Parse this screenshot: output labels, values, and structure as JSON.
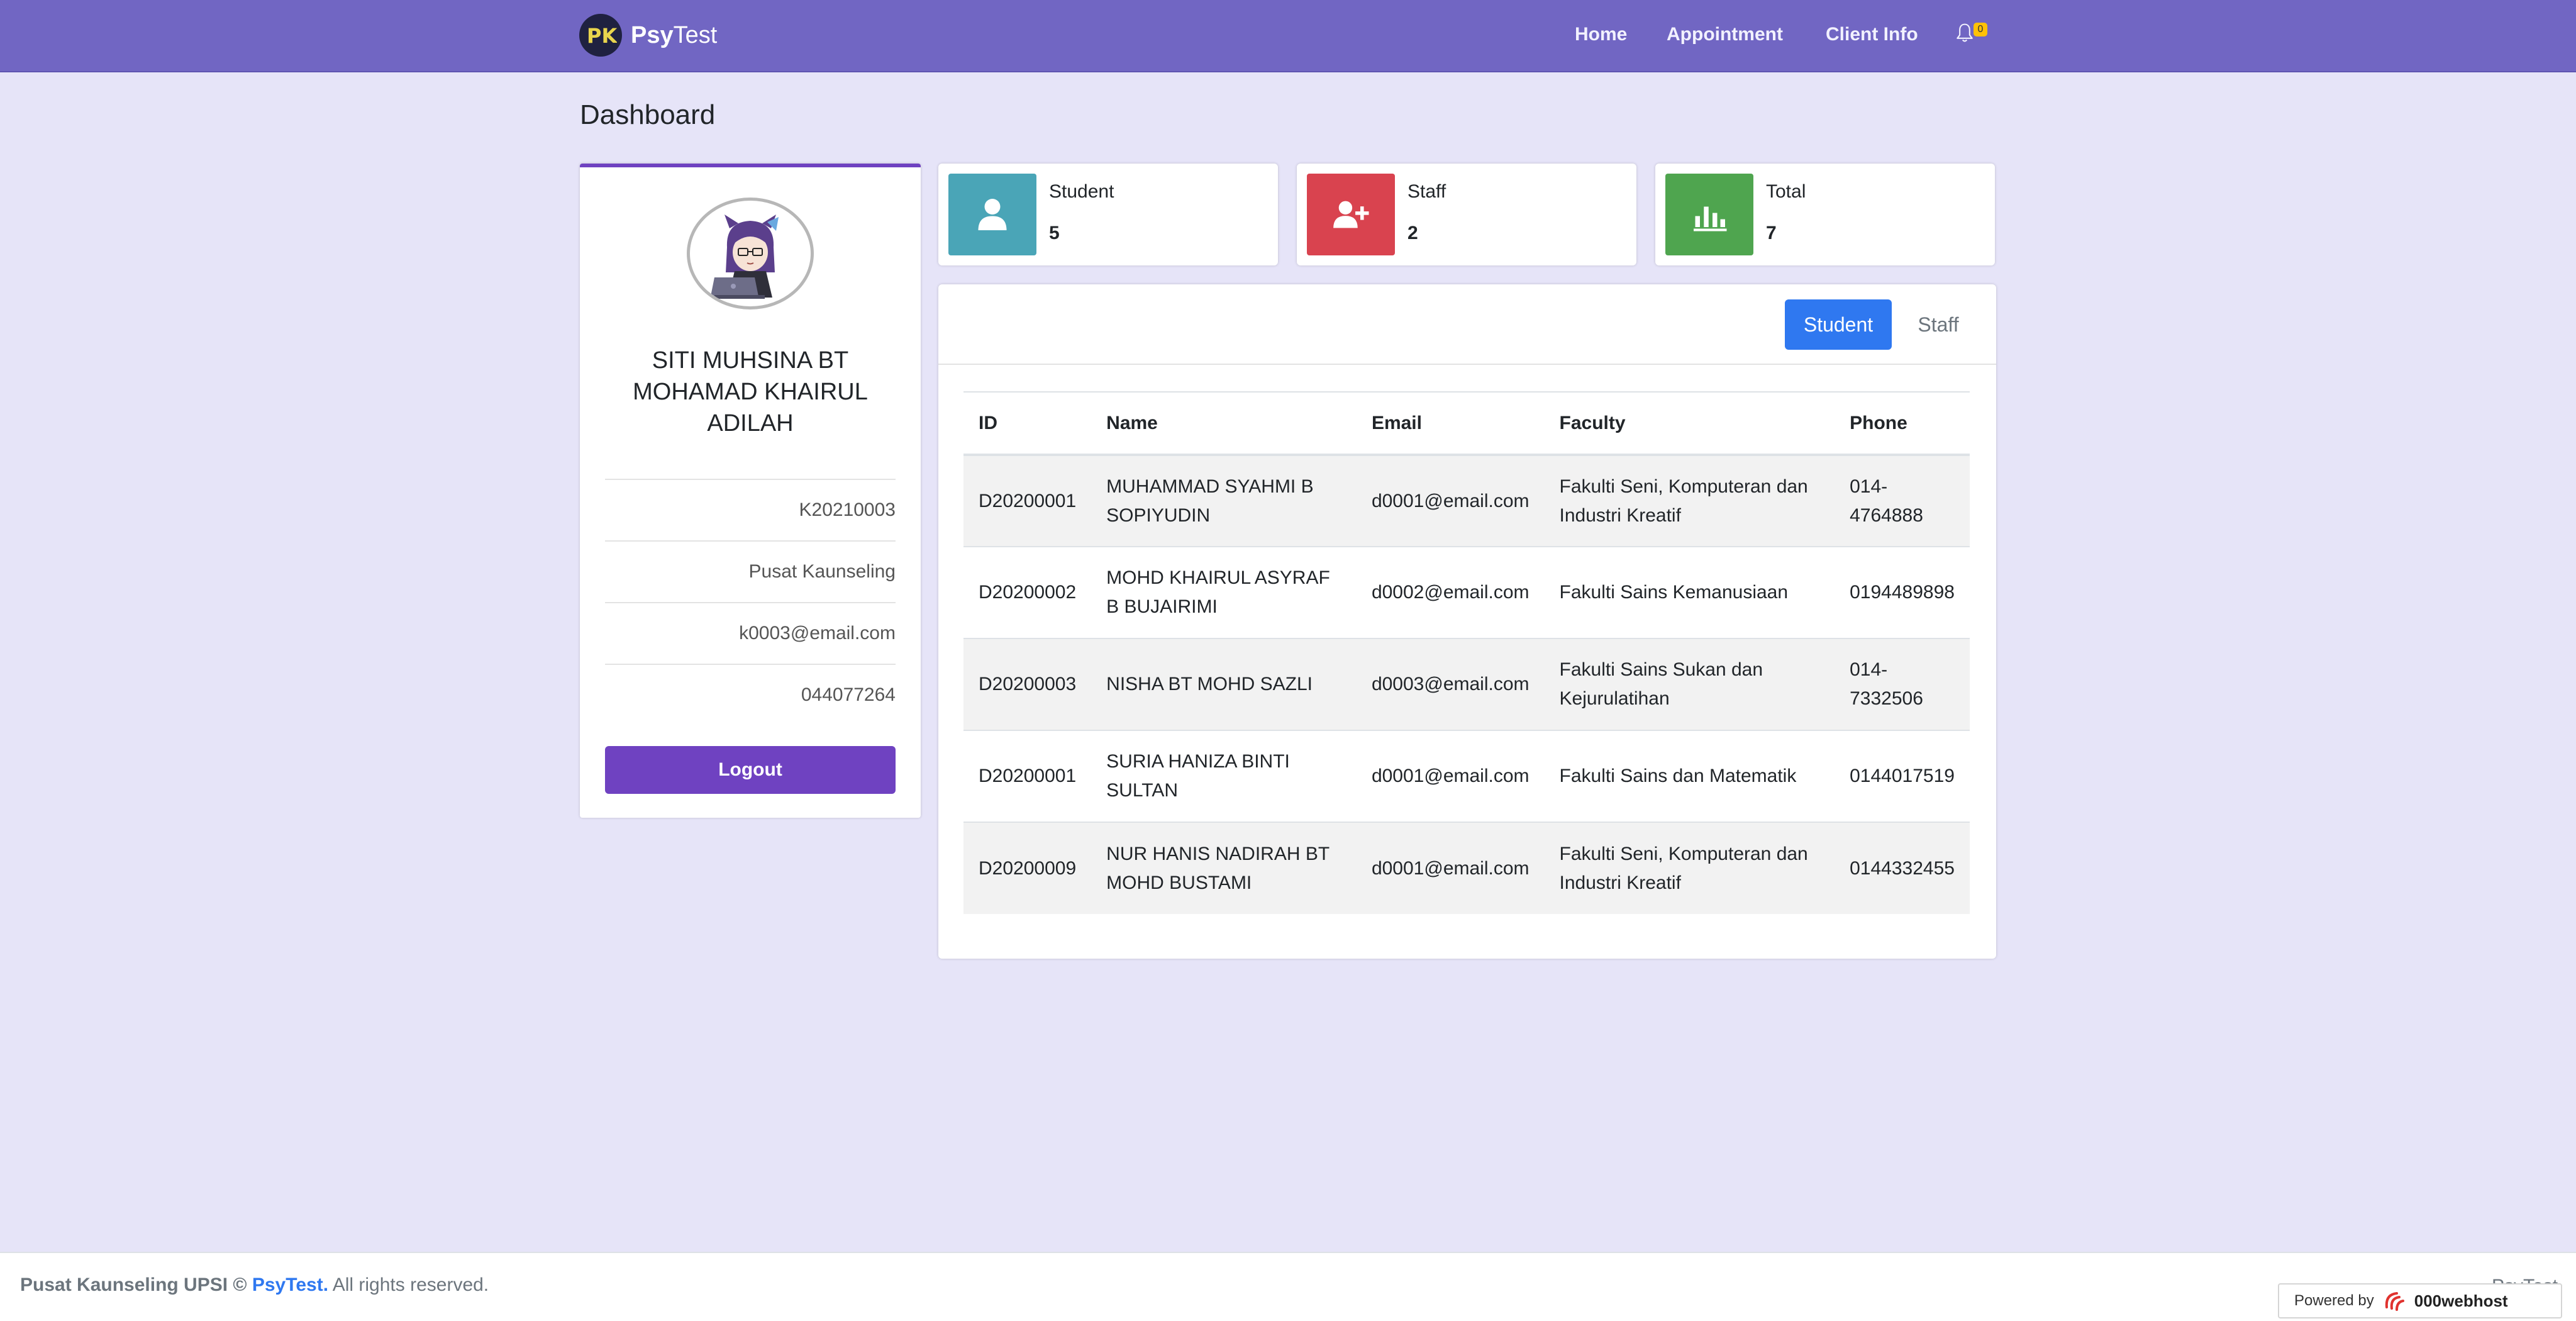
{
  "navbar": {
    "brand_bold": "Psy",
    "brand_light": "Test",
    "links": [
      {
        "label": "Home"
      },
      {
        "label": "Appointment"
      },
      {
        "label": "Client Info"
      }
    ],
    "notification_count": "0"
  },
  "page": {
    "title": "Dashboard"
  },
  "profile": {
    "name": "SITI MUHSINA BT MOHAMAD KHAIRUL ADILAH",
    "id": "K20210003",
    "department": "Pusat Kaunseling",
    "email": "k0003@email.com",
    "phone": "044077264",
    "logout_label": "Logout"
  },
  "stats": [
    {
      "label": "Student",
      "value": "5",
      "color": "#4aa5b7",
      "icon": "user-icon"
    },
    {
      "label": "Staff",
      "value": "2",
      "color": "#d9434f",
      "icon": "user-plus-icon"
    },
    {
      "label": "Total",
      "value": "7",
      "color": "#4fa54f",
      "icon": "bar-chart-icon"
    }
  ],
  "table_card": {
    "tabs": [
      {
        "label": "Student",
        "active": true
      },
      {
        "label": "Staff",
        "active": false
      }
    ],
    "columns": [
      "ID",
      "Name",
      "Email",
      "Faculty",
      "Phone"
    ],
    "rows": [
      {
        "id": "D20200001",
        "name": "MUHAMMAD SYAHMI B SOPIYUDIN",
        "email": "d0001@email.com",
        "faculty": "Fakulti Seni, Komputeran dan Industri Kreatif",
        "phone": "014-4764888"
      },
      {
        "id": "D20200002",
        "name": "MOHD KHAIRUL ASYRAF B BUJAIRIMI",
        "email": "d0002@email.com",
        "faculty": "Fakulti Sains Kemanusiaan",
        "phone": "0194489898"
      },
      {
        "id": "D20200003",
        "name": "NISHA BT MOHD SAZLI",
        "email": "d0003@email.com",
        "faculty": "Fakulti Sains Sukan dan Kejurulatihan",
        "phone": "014-7332506"
      },
      {
        "id": "D20200001",
        "name": "SURIA HANIZA BINTI SULTAN",
        "email": "d0001@email.com",
        "faculty": "Fakulti Sains dan Matematik",
        "phone": "0144017519"
      },
      {
        "id": "D20200009",
        "name": "NUR HANIS NADIRAH BT MOHD BUSTAMI",
        "email": "d0001@email.com",
        "faculty": "Fakulti Seni, Komputeran dan Industri Kreatif",
        "phone": "0144332455"
      }
    ]
  },
  "footer": {
    "org": "Pusat Kaunseling UPSI ©",
    "brand_link": "PsyTest.",
    "rights": "All rights reserved.",
    "right_text": "PsyTest",
    "powered_label": "Powered by",
    "powered_brand": "000webhost"
  }
}
